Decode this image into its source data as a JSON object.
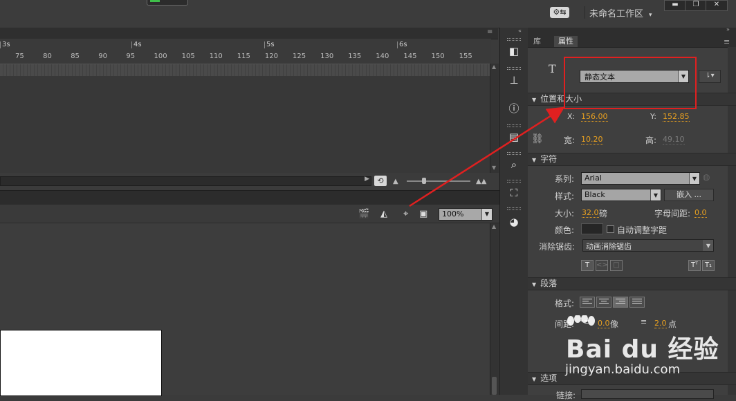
{
  "topbar": {
    "sync_label": "⚙⇆",
    "workspace_label": "未命名工作区",
    "workspace_caret": "▾",
    "window_buttons": [
      "▬",
      "❐",
      "✕"
    ]
  },
  "timeline": {
    "seconds": [
      "3s",
      "4s",
      "5s",
      "6s"
    ],
    "frames": [
      "75",
      "80",
      "85",
      "90",
      "95",
      "100",
      "105",
      "110",
      "115",
      "120",
      "125",
      "130",
      "135",
      "140",
      "145",
      "150",
      "155"
    ],
    "zoom_left_icon": "▲",
    "zoom_right_icon": "▲▲"
  },
  "stage": {
    "zoom_value": "100%",
    "toolbar_icons": [
      "clapper-icon",
      "paint-bucket-icon",
      "center-stage-icon",
      "clip-icon"
    ]
  },
  "dock": {
    "icons": [
      "library-icon",
      "align-icon",
      "info-icon",
      "transform-icon",
      "find-replace-icon",
      "frame-icon",
      "swatches-icon"
    ]
  },
  "properties": {
    "tabs": [
      "库",
      "属性"
    ],
    "active_tab": "属性",
    "tool_icon": "T",
    "text_type": "静态文本",
    "orient_label": "⇂▾",
    "position_section": "位置和大小",
    "x_label": "X:",
    "x_value": "156.00",
    "y_label": "Y:",
    "y_value": "152.85",
    "w_label": "宽:",
    "w_value": "10.20",
    "h_label": "高:",
    "h_value": "49.10",
    "char_section": "字符",
    "family_label": "系列:",
    "family_value": "Arial",
    "style_label": "样式:",
    "style_value": "Black",
    "embed_label": "嵌入 ...",
    "size_label": "大小:",
    "size_value": "32.0",
    "size_unit": "磅",
    "spacing_label": "字母间距:",
    "spacing_value": "0.0",
    "color_label": "颜色:",
    "autokern_label": "自动调整字距",
    "aa_label": "消除锯齿:",
    "aa_value": "动画消除锯齿",
    "para_section": "段落",
    "format_label": "格式:",
    "spacing2_label": "间距:",
    "indent_value": "0.0",
    "indent_unit": "像",
    "line_value": "2.0",
    "line_unit": "点",
    "options_section": "选项",
    "options_row_label": "链接:",
    "text_buttons": [
      "T",
      "<>",
      "□"
    ],
    "super_sub": [
      "Tᵀ",
      "T₁"
    ]
  },
  "watermark": {
    "brand": "Bai du 经验",
    "url": "jingyan.baidu.com"
  },
  "colors": {
    "accent_value": "#e8a020",
    "annotation": "#e02020",
    "panel_bg": "#3f3f3f"
  }
}
